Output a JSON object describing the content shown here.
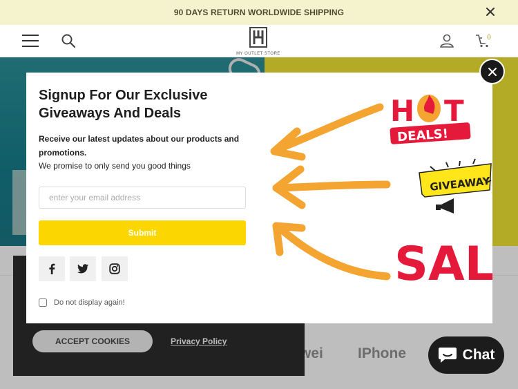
{
  "announcement": {
    "text": "90 DAYS RETURN WORLDWIDE SHIPPING"
  },
  "header": {
    "logo_text": "MY OUTLET STORE",
    "cart_count": "0"
  },
  "brands": {
    "item_a": "wei",
    "item_b": "IPhone"
  },
  "cookie_banner": {
    "accept_label": "ACCEPT COOKIES",
    "privacy_label": "Privacy Policy"
  },
  "popup": {
    "title": "Signup For Our Exclusive Giveaways And Deals",
    "subtitle": "Receive our latest updates about our products and promotions.",
    "promise": "We promise to only send you good things",
    "email_placeholder": "enter your email address",
    "submit_label": "Submit",
    "dont_show_label": "Do not display again!",
    "art": {
      "hot": "H",
      "hot_rest": "T",
      "deals": "DEALS!",
      "giveaway": "GIVEAWAY",
      "sale": "SALE"
    }
  },
  "chat": {
    "label": "Chat"
  },
  "colors": {
    "accent_yellow": "#fcd600",
    "announce_bg": "#f5f2ce",
    "teal": "#147886",
    "sale_red": "#e5193a",
    "arrow_orange": "#f3a431"
  }
}
